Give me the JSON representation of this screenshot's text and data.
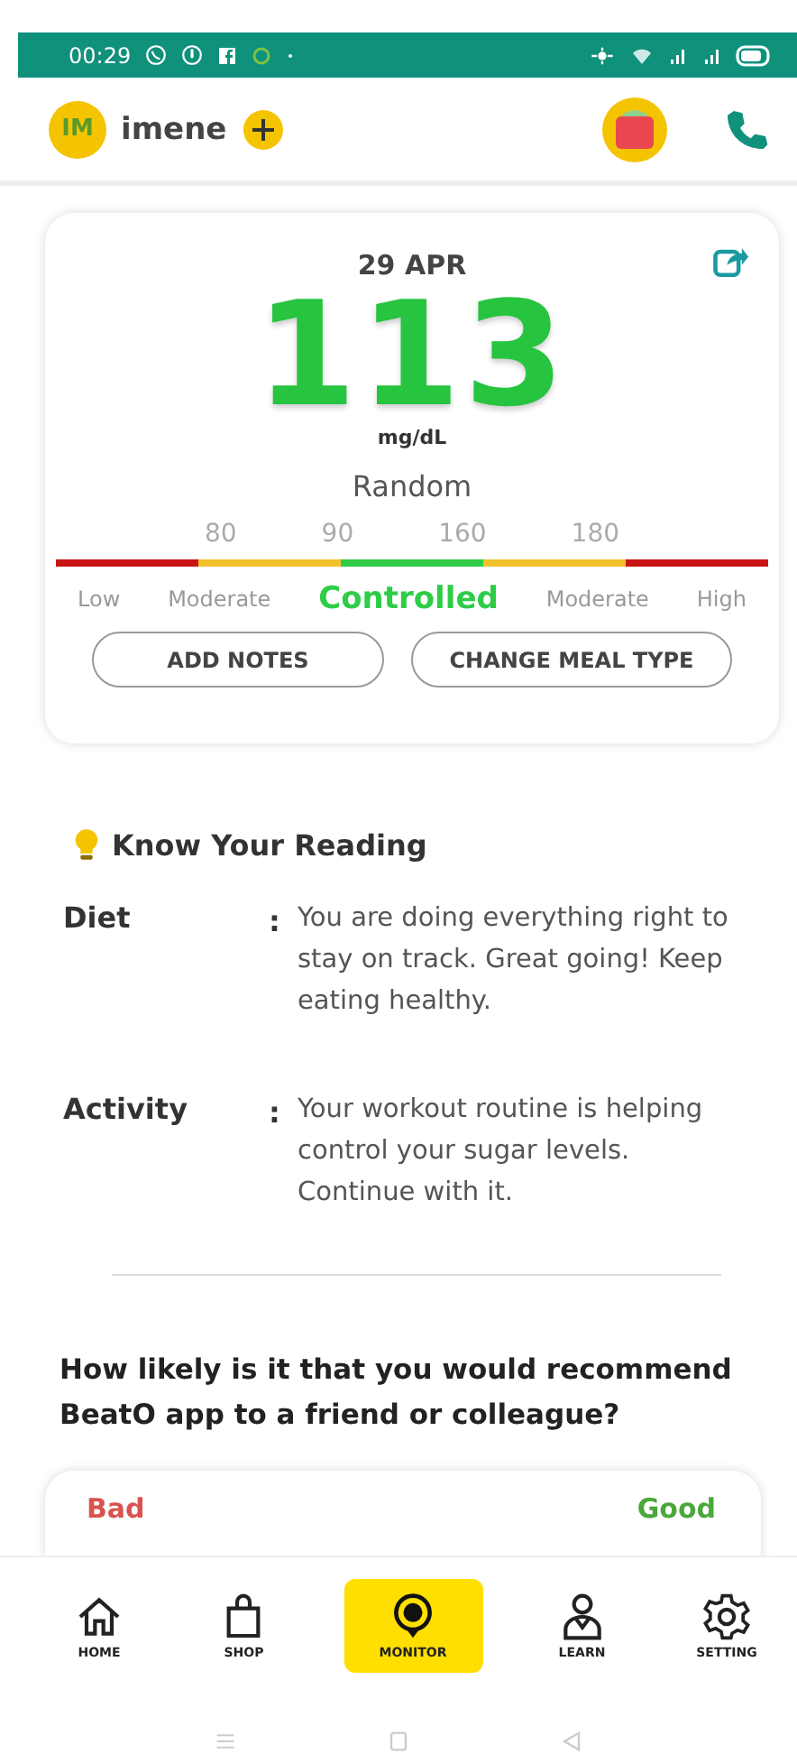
{
  "status_bar": {
    "time": "00:29"
  },
  "header": {
    "avatar_initials": "IM",
    "user_name": "imene"
  },
  "reading": {
    "date": "29 APR",
    "value": "113",
    "unit": "mg/dL",
    "meal_type": "Random",
    "thresholds": [
      "80",
      "90",
      "160",
      "180"
    ],
    "zones": [
      {
        "label": "Low",
        "color": "#c81414",
        "selected": false
      },
      {
        "label": "Moderate",
        "color": "#f2c12e",
        "selected": false
      },
      {
        "label": "Controlled",
        "color": "#2ecc47",
        "selected": true
      },
      {
        "label": "Moderate",
        "color": "#f2c12e",
        "selected": false
      },
      {
        "label": "High",
        "color": "#c81414",
        "selected": false
      }
    ],
    "buttons": [
      "ADD NOTES",
      "CHANGE MEAL TYPE"
    ]
  },
  "know_your_reading": {
    "title": "Know Your Reading",
    "rows": [
      {
        "label": "Diet",
        "separator": ":",
        "text": "You are doing everything right to stay on track. Great going! Keep eating healthy."
      },
      {
        "label": "Activity",
        "separator": ":",
        "text": "Your workout routine is helping control your sugar levels. Continue with it."
      }
    ]
  },
  "survey": {
    "question": "How likely is it that you would recommend BeatO app to a friend or colleague?",
    "low_label": "Bad",
    "high_label": "Good"
  },
  "bottom_nav": [
    {
      "kind": "home",
      "label": "HOME",
      "selected": false
    },
    {
      "kind": "shop",
      "label": "SHOP",
      "selected": false
    },
    {
      "kind": "monitor",
      "label": "MONITOR",
      "selected": true
    },
    {
      "kind": "learn",
      "label": "LEARN",
      "selected": false
    },
    {
      "kind": "setting",
      "label": "SETTING",
      "selected": false
    }
  ]
}
